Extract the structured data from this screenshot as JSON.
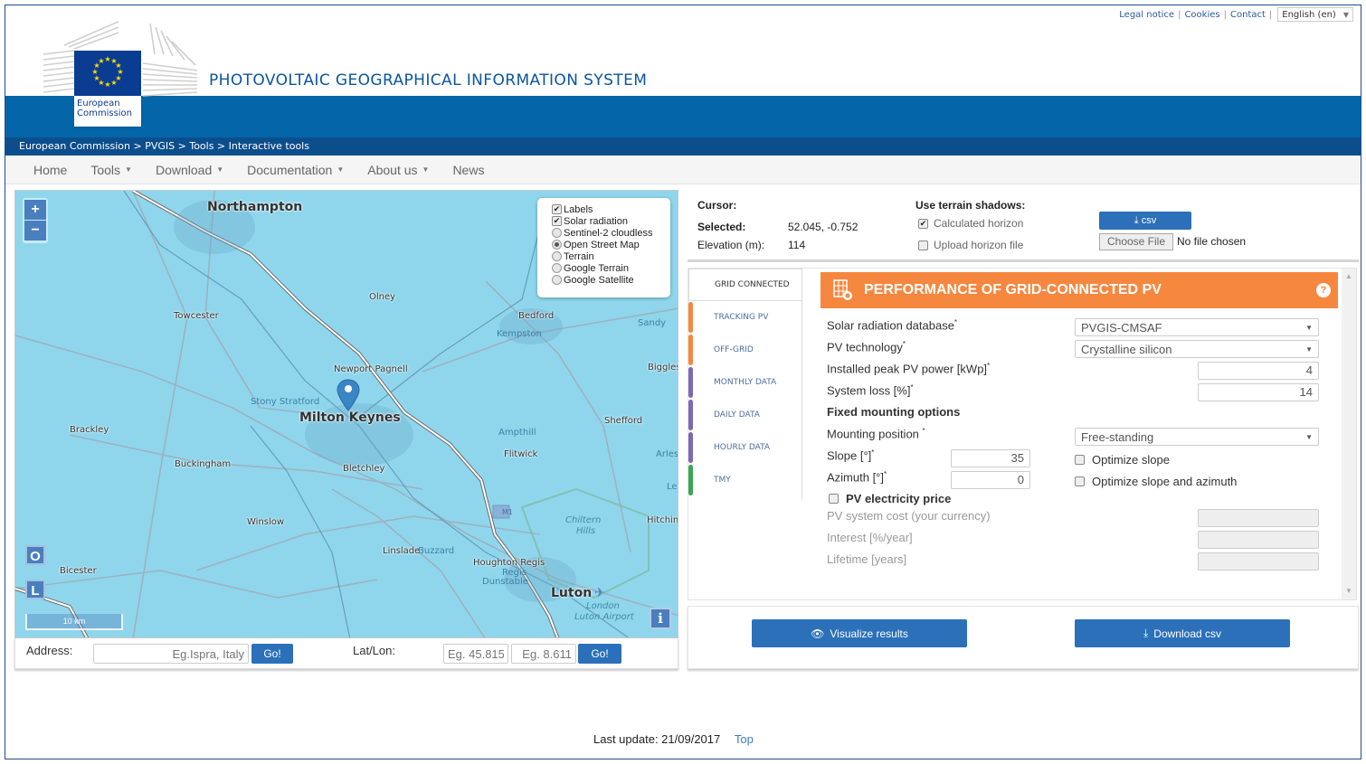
{
  "toplinks": {
    "legal": "Legal notice",
    "cookies": "Cookies",
    "contact": "Contact",
    "language": "English (en)"
  },
  "header": {
    "logo_label_line1": "European",
    "logo_label_line2": "Commission",
    "site_title": "PHOTOVOLTAIC GEOGRAPHICAL INFORMATION SYSTEM",
    "breadcrumb": "European Commission > PVGIS > Tools > Interactive tools"
  },
  "nav": [
    {
      "label": "Home",
      "dropdown": false
    },
    {
      "label": "Tools",
      "dropdown": true
    },
    {
      "label": "Download",
      "dropdown": true
    },
    {
      "label": "Documentation",
      "dropdown": true
    },
    {
      "label": "About us",
      "dropdown": true
    },
    {
      "label": "News",
      "dropdown": false
    }
  ],
  "map": {
    "zoom_in": "+",
    "zoom_out": "−",
    "layers": [
      {
        "label": "Labels",
        "type": "checkbox",
        "checked": true
      },
      {
        "label": "Solar radiation",
        "type": "checkbox",
        "checked": true
      },
      {
        "label": "Sentinel-2 cloudless",
        "type": "radio",
        "checked": false
      },
      {
        "label": "Open Street Map",
        "type": "radio",
        "checked": true
      },
      {
        "label": "Terrain",
        "type": "radio",
        "checked": false
      },
      {
        "label": "Google Terrain",
        "type": "radio",
        "checked": false
      },
      {
        "label": "Google Satellite",
        "type": "radio",
        "checked": false
      }
    ],
    "places": {
      "northampton": "Northampton",
      "towcester": "Towcester",
      "olney": "Olney",
      "bedford": "Bedford",
      "kempston": "Kempston",
      "sandy": "Sandy",
      "newport": "Newport Pagnell",
      "biggles": "Biggles",
      "stony": "Stony Stratford",
      "milton": "Milton Keynes",
      "brackley": "Brackley",
      "shefford": "Shefford",
      "ampthill": "Ampthill",
      "flitwick": "Flitwick",
      "arlesey": "Arles",
      "buckingham": "Buckingham",
      "bletchley": "Bletchley",
      "m1": "M1",
      "le": "Le",
      "winslow": "Winslow",
      "chiltern": "Chiltern",
      "hills": "Hills",
      "hitchin": "Hitchin",
      "linslade": "Linslade",
      "buzzard": "Buzzard",
      "houghton": "Houghton Regis",
      "regis": "Regis",
      "dunstable": "Dunstable",
      "bicester": "Bicester",
      "luton": "Luton",
      "airport1": "London",
      "airport2": "Luton Airport"
    },
    "o_button": "O",
    "l_button": "L",
    "scale": "10 km",
    "info_button": "i"
  },
  "search": {
    "address_label": "Address:",
    "address_placeholder": "Eg.Ispra, Italy",
    "go": "Go!",
    "latlon_label": "Lat/Lon:",
    "lat_placeholder": "Eg. 45.815",
    "lon_placeholder": "Eg. 8.611"
  },
  "location": {
    "cursor_label": "Cursor:",
    "selected_label": "Selected:",
    "selected_value": "52.045, -0.752",
    "elevation_label": "Elevation (m):",
    "elevation_value": "114",
    "terrain_label": "Use terrain shadows:",
    "calculated_horizon": "Calculated horizon",
    "calculated_horizon_checked": true,
    "upload_horizon": "Upload horizon file",
    "upload_horizon_checked": false,
    "csv_button": "csv",
    "choose_file": "Choose File",
    "no_file": "No file chosen"
  },
  "tabs": [
    {
      "label": "GRID CONNECTED",
      "color": "",
      "active": true
    },
    {
      "label": "TRACKING PV",
      "color": "#f6873f",
      "active": false
    },
    {
      "label": "OFF-GRID",
      "color": "#f6873f",
      "active": false
    },
    {
      "label": "MONTHLY DATA",
      "color": "#7e68b3",
      "active": false
    },
    {
      "label": "DAILY DATA",
      "color": "#7e68b3",
      "active": false
    },
    {
      "label": "HOURLY DATA",
      "color": "#7e68b3",
      "active": false
    },
    {
      "label": "TMY",
      "color": "#3aa557",
      "active": false
    }
  ],
  "form": {
    "title": "PERFORMANCE OF GRID-CONNECTED PV",
    "help": "?",
    "radiation_db_label": "Solar radiation database",
    "radiation_db_value": "PVGIS-CMSAF",
    "pv_tech_label": "PV technology",
    "pv_tech_value": "Crystalline silicon",
    "peak_power_label": "Installed peak PV power [kWp]",
    "peak_power_value": "4",
    "system_loss_label": "System loss [%]",
    "system_loss_value": "14",
    "fixed_mounting_heading": "Fixed mounting options",
    "mounting_position_label": "Mounting position ",
    "mounting_position_value": "Free-standing",
    "slope_label": "Slope [°]",
    "slope_value": "35",
    "azimuth_label": "Azimuth [°]",
    "azimuth_value": "0",
    "optimize_slope": "Optimize slope",
    "optimize_slope_azimuth": "Optimize slope and azimuth",
    "pv_price_label": "PV electricity price",
    "system_cost_label": "PV system cost (your currency)",
    "interest_label": "Interest [%/year]",
    "lifetime_label": "Lifetime [years]",
    "required_mark": "*"
  },
  "actions": {
    "visualize": "Visualize results",
    "download": "Download csv"
  },
  "footer": {
    "last_update": "Last update: 21/09/2017",
    "top": "Top"
  },
  "colors": {
    "brand_blue": "#0466a8",
    "button_blue": "#2b70b8",
    "orange": "#f6873f"
  }
}
